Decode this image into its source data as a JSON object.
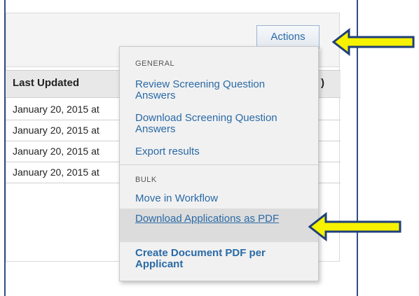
{
  "toolbar": {
    "actions_label": "Actions"
  },
  "table": {
    "headers": {
      "last_updated": "Last Updated",
      "right_header": ")"
    },
    "rows": [
      {
        "last_updated": "January 20, 2015 at"
      },
      {
        "last_updated": "January 20, 2015 at"
      },
      {
        "last_updated": "January 20, 2015 at"
      },
      {
        "last_updated": "January 20, 2015 at"
      }
    ]
  },
  "menu": {
    "general_label": "GENERAL",
    "general_items": [
      "Review Screening Question Answers",
      "Download Screening Question Answers",
      "Export results"
    ],
    "bulk_label": "BULK",
    "bulk_items": [
      "Move in Workflow",
      "Download Applications as PDF",
      "Create Document PDF per Applicant"
    ]
  },
  "colors": {
    "link": "#2a6aa6",
    "frame": "#2f4f82",
    "arrow_fill": "#f6f200",
    "arrow_stroke": "#1f3f7a"
  }
}
